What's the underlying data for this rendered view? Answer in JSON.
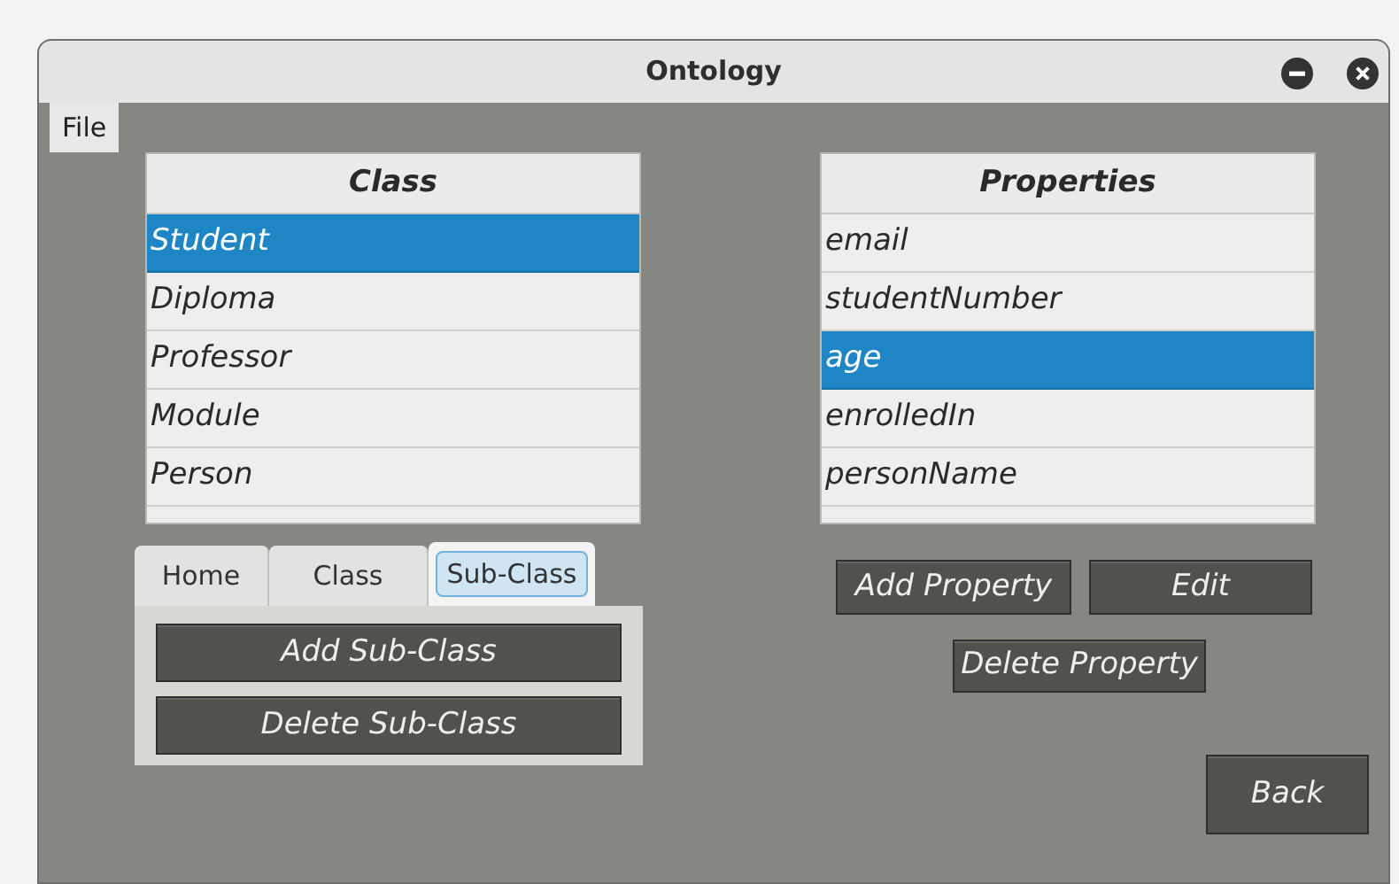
{
  "window": {
    "title": "Ontology"
  },
  "menu": [
    {
      "label": "File"
    }
  ],
  "class_list": {
    "header": "Class",
    "items": [
      {
        "label": "Student",
        "selected": true
      },
      {
        "label": "Diploma",
        "selected": false
      },
      {
        "label": "Professor",
        "selected": false
      },
      {
        "label": "Module",
        "selected": false
      },
      {
        "label": "Person",
        "selected": false
      }
    ]
  },
  "properties_list": {
    "header": "Properties",
    "items": [
      {
        "label": "email",
        "selected": false
      },
      {
        "label": "studentNumber",
        "selected": false
      },
      {
        "label": "age",
        "selected": true
      },
      {
        "label": "enrolledIn",
        "selected": false
      },
      {
        "label": "personName",
        "selected": false
      }
    ]
  },
  "tabs": [
    {
      "label": "Home",
      "selected": false
    },
    {
      "label": "Class",
      "selected": false
    },
    {
      "label": "Sub-Class",
      "selected": true
    }
  ],
  "tab_buttons": [
    "Add Sub-Class",
    "Delete Sub-Class"
  ],
  "property_buttons": [
    "Add Property",
    "Edit",
    "Delete Property"
  ],
  "back_button": "Back"
}
